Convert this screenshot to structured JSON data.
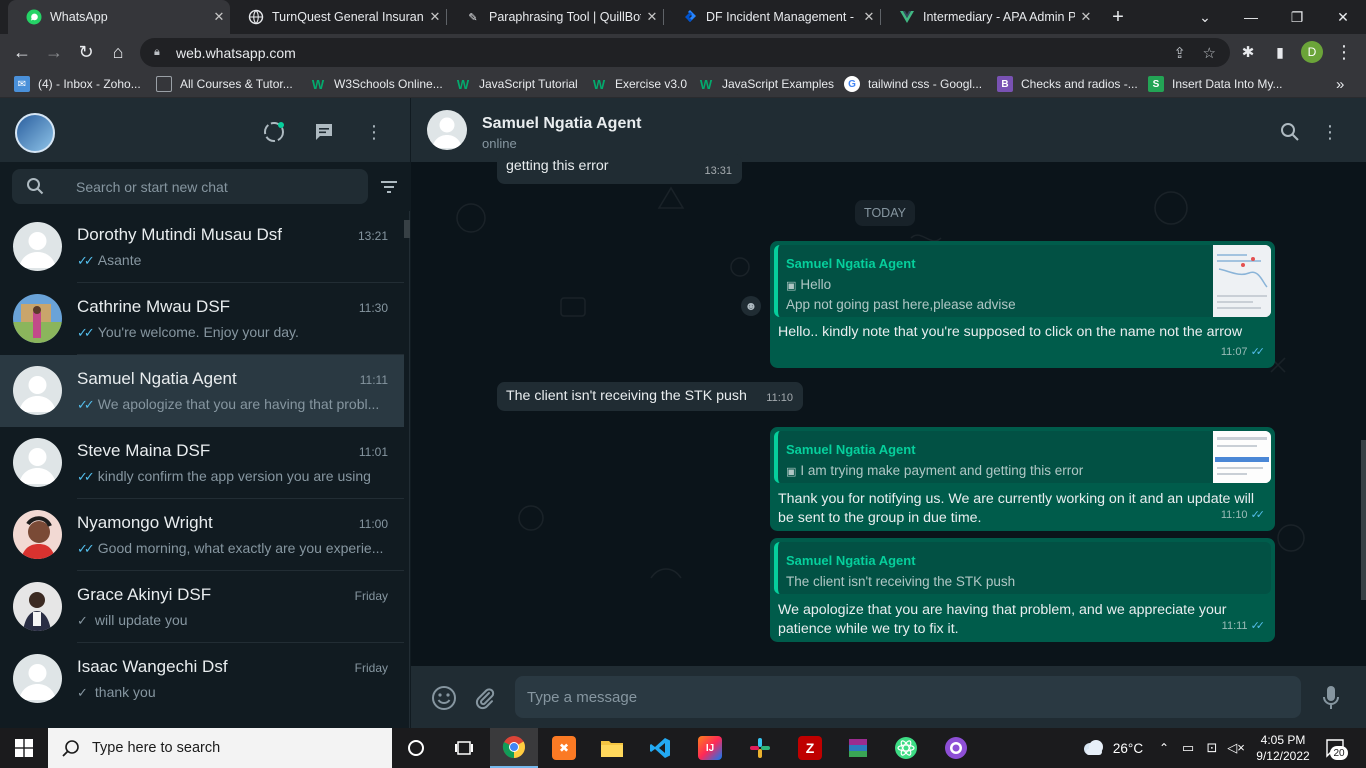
{
  "browser": {
    "tabs": [
      {
        "title": "WhatsApp",
        "active": true
      },
      {
        "title": "TurnQuest General Insurance"
      },
      {
        "title": "Paraphrasing Tool | QuillBot A"
      },
      {
        "title": "DF Incident Management - K"
      },
      {
        "title": "Intermediary - APA Admin Po"
      }
    ],
    "new_tab": "+",
    "url": "web.whatsapp.com",
    "profile_initial": "D",
    "bookmarks": [
      "(4) - Inbox - Zoho...",
      "All Courses & Tutor...",
      "W3Schools Online...",
      "JavaScript Tutorial",
      "Exercise v3.0",
      "JavaScript Examples",
      "tailwind css - Googl...",
      "Checks and radios -...",
      "Insert Data Into My..."
    ],
    "bookmarks_overflow": "»"
  },
  "sidebar": {
    "search_placeholder": "Search or start new chat",
    "chats": [
      {
        "name": "Dorothy Mutindi Musau Dsf",
        "time": "13:21",
        "preview": "Asante",
        "ticks": "double"
      },
      {
        "name": "Cathrine Mwau DSF",
        "time": "11:30",
        "preview": "You're welcome. Enjoy your day.",
        "ticks": "double"
      },
      {
        "name": "Samuel Ngatia Agent",
        "time": "11:11",
        "preview": "We apologize that you are having that probl...",
        "ticks": "double",
        "selected": true
      },
      {
        "name": "Steve Maina DSF",
        "time": "11:01",
        "preview": "kindly confirm the app version you are using",
        "ticks": "double"
      },
      {
        "name": "Nyamongo Wright",
        "time": "11:00",
        "preview": "Good morning, what exactly are you experie...",
        "ticks": "double"
      },
      {
        "name": "Grace Akinyi DSF",
        "time": "Friday",
        "preview": "will update you",
        "ticks": "single"
      },
      {
        "name": "Isaac Wangechi Dsf",
        "time": "Friday",
        "preview": "thank you",
        "ticks": "single"
      }
    ]
  },
  "conversation": {
    "contact_name": "Samuel Ngatia Agent",
    "status": "online",
    "messages": [
      {
        "text": "getting this error",
        "time": "13:31",
        "dir": "in"
      },
      {
        "date_chip": "TODAY"
      },
      {
        "quote_name": "Samuel Ngatia Agent",
        "quote_line1": "Hello",
        "quote_line2": "App not going past here,please advise",
        "text": "Hello.. kindly note that you're supposed to click on the name not the arrow",
        "time": "11:07",
        "dir": "out"
      },
      {
        "text": "The client isn't receiving the STK push",
        "time": "11:10",
        "dir": "in"
      },
      {
        "quote_name": "Samuel Ngatia Agent",
        "quote_line1": "I am trying make payment and getting this error",
        "text_line1": "Thank you for notifying us. We are currently working on it and an update will",
        "text_line2": "be sent to the group in due time.",
        "time": "11:10",
        "dir": "out"
      },
      {
        "quote_name": "Samuel Ngatia Agent",
        "quote_line1": "The client isn't receiving the STK push",
        "text_line1": "We apologize that you are having that problem, and we appreciate your",
        "text_line2": "patience while we try to fix it.",
        "time": "11:11",
        "dir": "out"
      }
    ],
    "composer_placeholder": "Type a message"
  },
  "taskbar": {
    "search_placeholder": "Type here to search",
    "weather": "26°C",
    "time": "4:05 PM",
    "date": "9/12/2022",
    "notifications": "20"
  },
  "colors": {
    "panel": "#202c33",
    "background": "#111b21",
    "outgoing_bubble": "#005c4b",
    "accent": "#06cf9c",
    "read_tick": "#53bdeb"
  }
}
